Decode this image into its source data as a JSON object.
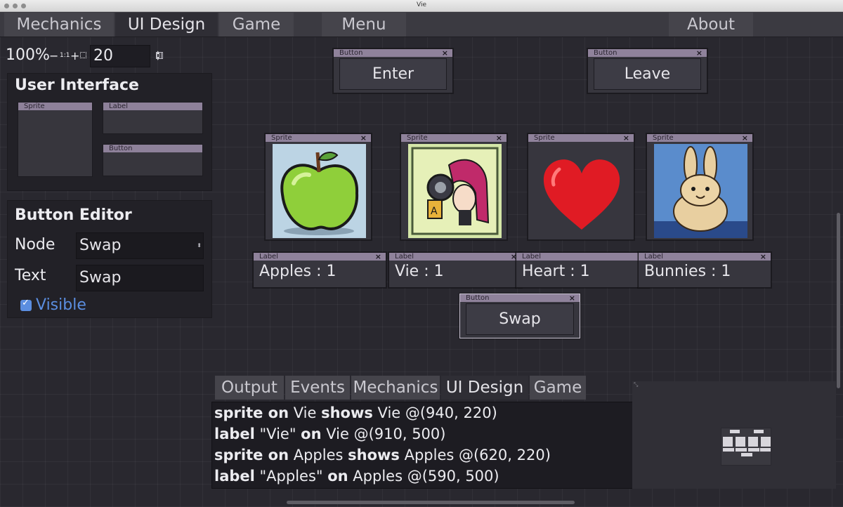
{
  "window_title": "Vie",
  "top_tabs": [
    {
      "label": "Mechanics"
    },
    {
      "label": "UI Design"
    },
    {
      "label": "Game"
    },
    {
      "label": "Menu"
    },
    {
      "label": "About"
    }
  ],
  "zoom": {
    "percent": "100%",
    "minus": "−",
    "reset": "1:1",
    "plus": "+",
    "grid_value": "20"
  },
  "ui_panel": {
    "title": "User Interface",
    "palette": [
      {
        "type": "Sprite"
      },
      {
        "type": "Label"
      },
      {
        "type": "Button"
      }
    ]
  },
  "button_editor": {
    "title": "Button Editor",
    "node_label": "Node",
    "node_value": "Swap",
    "text_label": "Text",
    "text_value": "Swap",
    "visible_label": "Visible",
    "visible_checked": true
  },
  "nodes": {
    "enter": {
      "type": "Button",
      "text": "Enter"
    },
    "leave": {
      "type": "Button",
      "text": "Leave"
    },
    "swap": {
      "type": "Button",
      "text": "Swap"
    },
    "sprites": [
      {
        "type": "Sprite",
        "image": "apple"
      },
      {
        "type": "Sprite",
        "image": "vie-character"
      },
      {
        "type": "Sprite",
        "image": "heart"
      },
      {
        "type": "Sprite",
        "image": "bunny"
      }
    ],
    "labels": [
      {
        "type": "Label",
        "text": "Apples : 1"
      },
      {
        "type": "Label",
        "text": "Vie : 1"
      },
      {
        "type": "Label",
        "text": "Heart : 1"
      },
      {
        "type": "Label",
        "text": "Bunnies : 1"
      }
    ],
    "close_glyph": "×"
  },
  "bottom_tabs": [
    {
      "label": "Output"
    },
    {
      "label": "Events"
    },
    {
      "label": "Mechanics"
    },
    {
      "label": "UI Design"
    },
    {
      "label": "Game"
    }
  ],
  "log": [
    {
      "k1": "sprite on",
      "t1": " Vie ",
      "k2": "shows",
      "t2": " Vie @(940, 220)"
    },
    {
      "k1": "label",
      "t1": " \"Vie\" ",
      "k2": "on",
      "t2": " Vie @(910, 500)"
    },
    {
      "k1": "sprite on",
      "t1": " Apples ",
      "k2": "shows",
      "t2": " Apples @(620, 220)"
    },
    {
      "k1": "label",
      "t1": " \"Apples\" ",
      "k2": "on",
      "t2": " Apples @(590, 500)"
    }
  ],
  "colors": {
    "accent": "#5b8ee0",
    "node_header": "#8f829b",
    "background": "#29282f"
  }
}
